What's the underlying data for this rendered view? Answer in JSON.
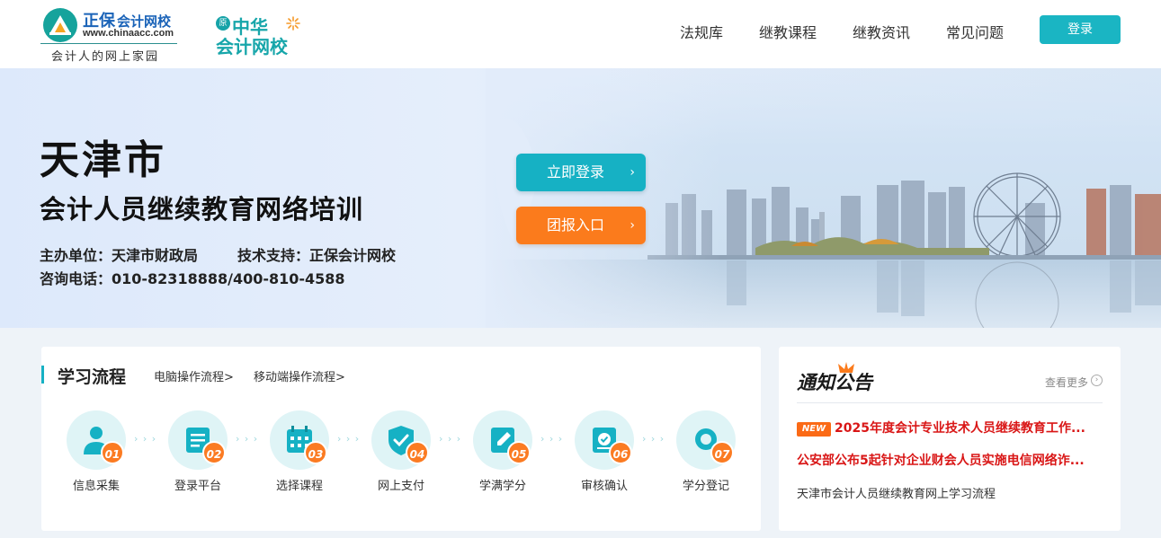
{
  "header": {
    "brand": "正保",
    "brand_sub": "会计网校",
    "url": "www.chinaacc.com",
    "slogan": "会计人的网上家园",
    "partner_badge": "原",
    "partner_line1": "中华",
    "partner_line2": "会计网校",
    "nav": [
      "法规库",
      "继教课程",
      "继教资讯",
      "常见问题"
    ],
    "login_label": "登录"
  },
  "hero": {
    "city": "天津市",
    "subtitle": "会计人员继续教育网络培训",
    "organizer": "主办单位：天津市财政局",
    "tech_support": "技术支持：正保会计网校",
    "hotline": "咨询电话：010-82318888/400-810-4588",
    "login_now": "立即登录",
    "group_entry": "团报入口",
    "arrow": "›"
  },
  "flow": {
    "title": "学习流程",
    "pc_link": "电脑操作流程>",
    "mobile_link": "移动端操作流程>",
    "arrow_glyph": "› › ›",
    "steps": [
      {
        "num": "01",
        "label": "信息采集",
        "icon": "user-icon"
      },
      {
        "num": "02",
        "label": "登录平台",
        "icon": "document-icon"
      },
      {
        "num": "03",
        "label": "选择课程",
        "icon": "calendar-icon"
      },
      {
        "num": "04",
        "label": "网上支付",
        "icon": "shield-check-icon"
      },
      {
        "num": "05",
        "label": "学满学分",
        "icon": "edit-icon"
      },
      {
        "num": "06",
        "label": "审核确认",
        "icon": "review-check-icon"
      },
      {
        "num": "07",
        "label": "学分登记",
        "icon": "record-icon"
      }
    ]
  },
  "notice": {
    "title": "通知公告",
    "more": "查看更多",
    "more_icon": "›",
    "new_badge": "NEW",
    "items": [
      {
        "text": "2025年度会计专业技术人员继续教育工作...",
        "hot": true,
        "is_new": true
      },
      {
        "text": "公安部公布5起针对企业财会人员实施电信网络诈...",
        "hot": true,
        "is_new": false
      },
      {
        "text": "天津市会计人员继续教育网上学习流程",
        "hot": false,
        "is_new": false
      }
    ]
  },
  "colors": {
    "accent": "#16b1c4",
    "orange": "#fb7b1c",
    "hot_red": "#d91616",
    "brand_blue": "#1a63b8"
  }
}
